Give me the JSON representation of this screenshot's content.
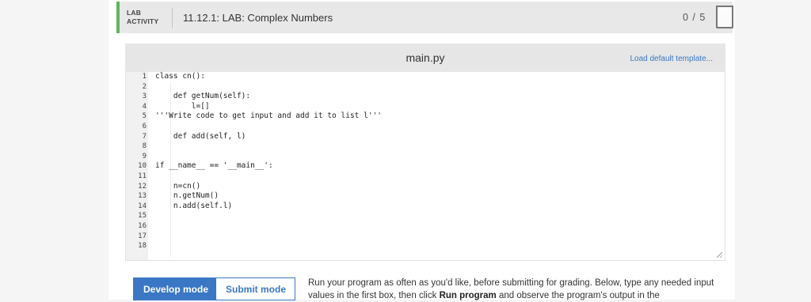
{
  "header": {
    "badge_line1": "LAB",
    "badge_line2": "ACTIVITY",
    "title": "11.12.1: LAB: Complex Numbers",
    "score": "0 / 5",
    "accent_color": "#5cb85c"
  },
  "editor": {
    "filename": "main.py",
    "load_template_label": "Load default template...",
    "line_numbers": [
      "1",
      "2",
      "3",
      "4",
      "5",
      "6",
      "7",
      "8",
      "9",
      "10",
      "11",
      "12",
      "13",
      "14",
      "15",
      "16",
      "17",
      "18"
    ],
    "lines": [
      "class cn():",
      "",
      "    def getNum(self):",
      "        l=[]",
      "'''Write code to get input and add it to list l'''",
      "",
      "    def add(self, l)",
      "",
      "",
      "if __name__ == '__main__':",
      "",
      "    n=cn()",
      "    n.getNum()",
      "    n.add(self.l)",
      "",
      "",
      "",
      ""
    ]
  },
  "modes": {
    "develop_label": "Develop mode",
    "submit_label": "Submit mode",
    "active": "Develop mode"
  },
  "instructions": {
    "text_1": "Run your program as often as you'd like, before submitting for grading. Below, type any needed input values in the first box, then click ",
    "bold_run": "Run program",
    "text_2": " and observe the program's output in the"
  },
  "colors": {
    "link": "#3a77c4",
    "active_button": "#3a77c4"
  }
}
